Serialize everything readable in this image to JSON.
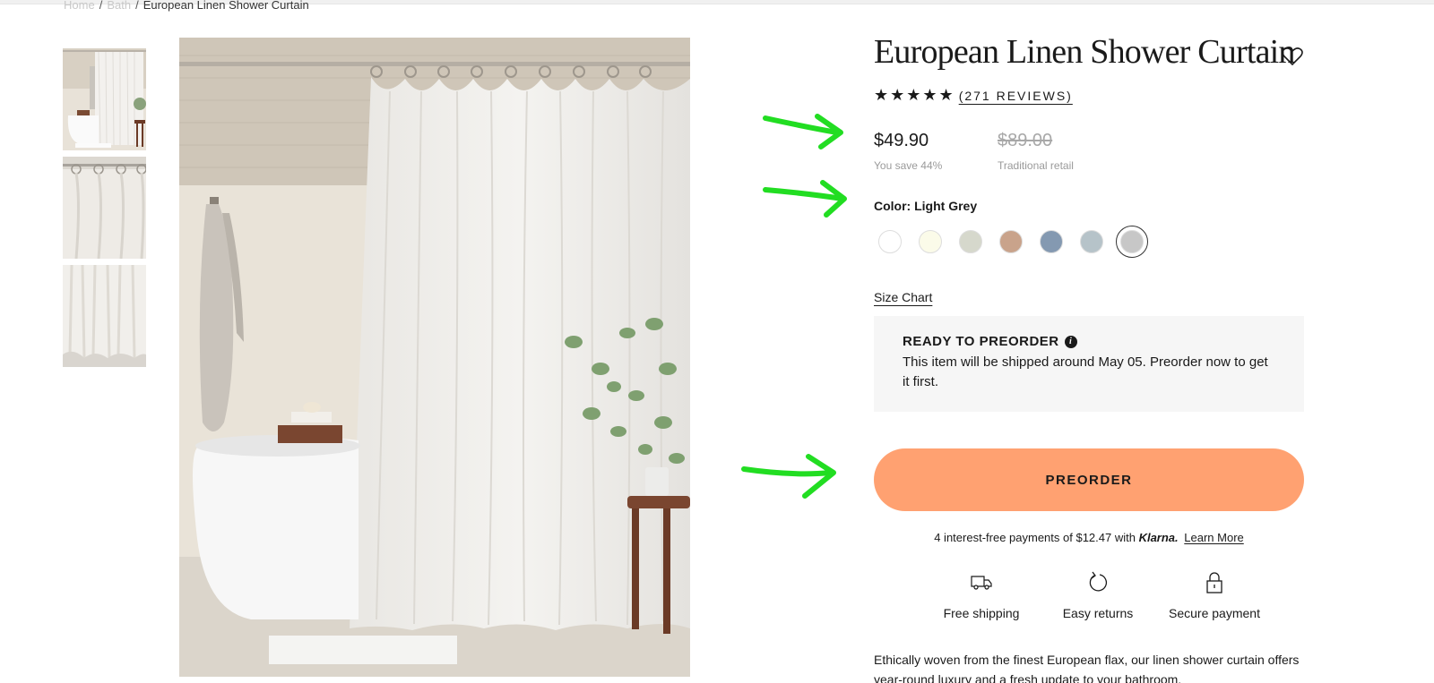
{
  "breadcrumb": {
    "items": [
      "Home",
      "Bath",
      "European Linen Shower Curtain"
    ],
    "separator": "/"
  },
  "product": {
    "title": "European Linen Shower Curtain",
    "stars": "★★★★★",
    "rating_stars": 5,
    "reviews_label": "(271 REVIEWS)",
    "price": "$49.90",
    "save_text": "You save 44%",
    "retail_price": "$89.00",
    "retail_label": "Traditional retail"
  },
  "color": {
    "label": "Color: Light Grey",
    "swatches": [
      {
        "name": "white",
        "hex": "#ffffff"
      },
      {
        "name": "cream",
        "hex": "#fbfbe9"
      },
      {
        "name": "sage",
        "hex": "#d6d8cc"
      },
      {
        "name": "tan",
        "hex": "#c9a38b"
      },
      {
        "name": "blue",
        "hex": "#8499b1"
      },
      {
        "name": "mist",
        "hex": "#b6c3c9"
      },
      {
        "name": "light-grey",
        "hex": "#c7c7c7",
        "selected": true
      }
    ]
  },
  "size_chart_label": "Size Chart",
  "preorder_notice": {
    "heading": "READY TO PREORDER",
    "text": "This item will be shipped around May 05. Preorder now to get it first."
  },
  "preorder_button_label": "PREORDER",
  "klarna": {
    "prefix": "4 interest-free payments of $12.47 with",
    "brand": "Klarna.",
    "link": "Learn More"
  },
  "features": [
    {
      "icon": "truck-icon",
      "label": "Free shipping"
    },
    {
      "icon": "return-icon",
      "label": "Easy returns"
    },
    {
      "icon": "lock-icon",
      "label": "Secure payment"
    }
  ],
  "description": "Ethically woven from the finest European flax, our linen shower curtain offers year-round luxury and a fresh update to your bathroom.",
  "colors": {
    "accent": "#ffa171",
    "annotation_arrow": "#22dd22",
    "notice_bg": "#f6f6f6"
  }
}
